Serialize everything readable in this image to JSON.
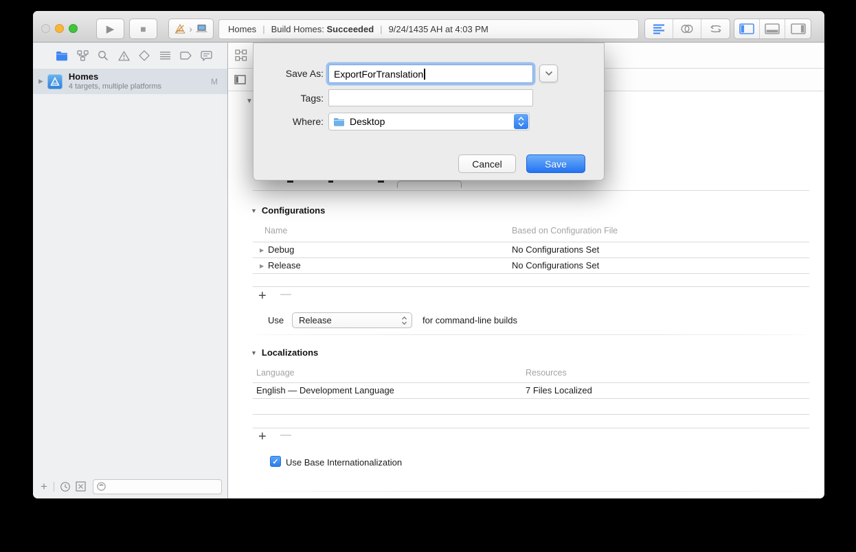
{
  "icons": {
    "play": "▶",
    "stop": "■",
    "chevron_right": "›",
    "disclosure_collapsed": "▶",
    "disclosure_expanded": "▼",
    "plus": "+",
    "minus": "—",
    "check": "✓"
  },
  "colors": {
    "accent_blue": "#3b82f5",
    "save_button_blue": "#2273f2",
    "traffic_yellow": "#f7b53b",
    "traffic_green": "#3fc43c",
    "traffic_inactive_gray": "#d9d9d9",
    "selection_row": "#dbe0e7"
  },
  "toolbar": {
    "status": {
      "project": "Homes",
      "separator": "|",
      "build_label": "Build Homes:",
      "build_status": "Succeeded",
      "timestamp": "9/24/1435 AH at 4:03 PM"
    }
  },
  "sidebar": {
    "project": {
      "name": "Homes",
      "subtitle": "4 targets, multiple platforms",
      "badge": "M"
    }
  },
  "save_dialog": {
    "save_as_label": "Save As:",
    "save_as_value": "ExportForTranslation",
    "tags_label": "Tags:",
    "tags_value": "",
    "where_label": "Where:",
    "where_value": "Desktop",
    "cancel_button": "Cancel",
    "save_button": "Save"
  },
  "editor": {
    "configurations": {
      "title": "Configurations",
      "col_name": "Name",
      "col_based_on": "Based on Configuration File",
      "rows": [
        {
          "name": "Debug",
          "based_on": "No Configurations Set"
        },
        {
          "name": "Release",
          "based_on": "No Configurations Set"
        }
      ],
      "use_prefix": "Use",
      "use_value": "Release",
      "use_suffix": "for command-line builds"
    },
    "localizations": {
      "title": "Localizations",
      "col_language": "Language",
      "col_resources": "Resources",
      "rows": [
        {
          "language": "English — Development Language",
          "resources": "7 Files Localized"
        }
      ],
      "use_base_label": "Use Base Internationalization"
    }
  }
}
